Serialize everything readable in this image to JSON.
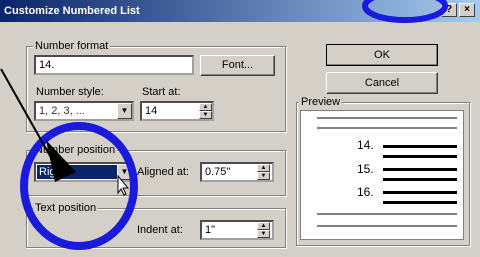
{
  "dialog": {
    "title": "Customize Numbered List",
    "help_label": "?",
    "close_label": "×"
  },
  "number_format": {
    "group_label": "Number format",
    "value": "14.",
    "font_button": "Font...",
    "style_label": "Number style:",
    "style_value": "1, 2, 3, ...",
    "start_label": "Start at:",
    "start_value": "14"
  },
  "number_position": {
    "group_label": "Number position",
    "alignment_value": "Right",
    "aligned_label": "Aligned at:",
    "aligned_value": "0.75\""
  },
  "text_position": {
    "group_label": "Text position",
    "indent_label": "Indent at:",
    "indent_value": "1\""
  },
  "buttons": {
    "ok": "OK",
    "cancel": "Cancel"
  },
  "preview": {
    "label": "Preview",
    "numbers": [
      "14.",
      "15.",
      "16."
    ]
  },
  "colors": {
    "titlebar": "#0a246a",
    "highlight_selection": "#0a246a",
    "annotation_circle": "#1a1adc"
  }
}
